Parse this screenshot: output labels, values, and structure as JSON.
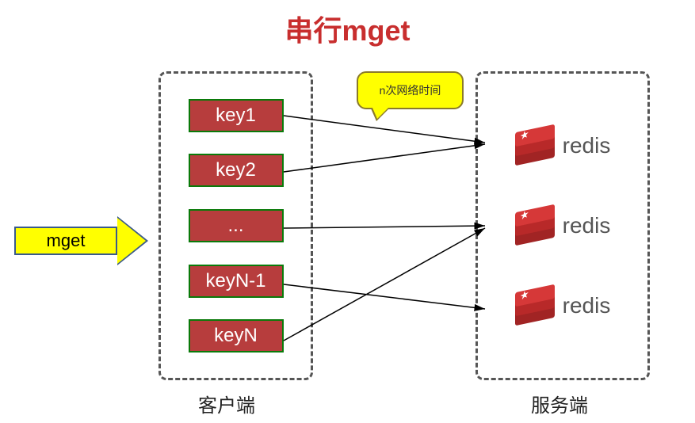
{
  "title": "串行mget",
  "mget_label": "mget",
  "client": {
    "label": "客户端",
    "keys": [
      "key1",
      "key2",
      "...",
      "keyN-1",
      "keyN"
    ]
  },
  "callout": {
    "text": "n次网络时间"
  },
  "server": {
    "label": "服务端",
    "nodes": [
      "redis",
      "redis",
      "redis"
    ]
  },
  "connections": [
    {
      "from_key_index": 0,
      "to_server_index": 0
    },
    {
      "from_key_index": 1,
      "to_server_index": 0
    },
    {
      "from_key_index": 2,
      "to_server_index": 1
    },
    {
      "from_key_index": 3,
      "to_server_index": 2
    },
    {
      "from_key_index": 4,
      "to_server_index": 1
    }
  ]
}
